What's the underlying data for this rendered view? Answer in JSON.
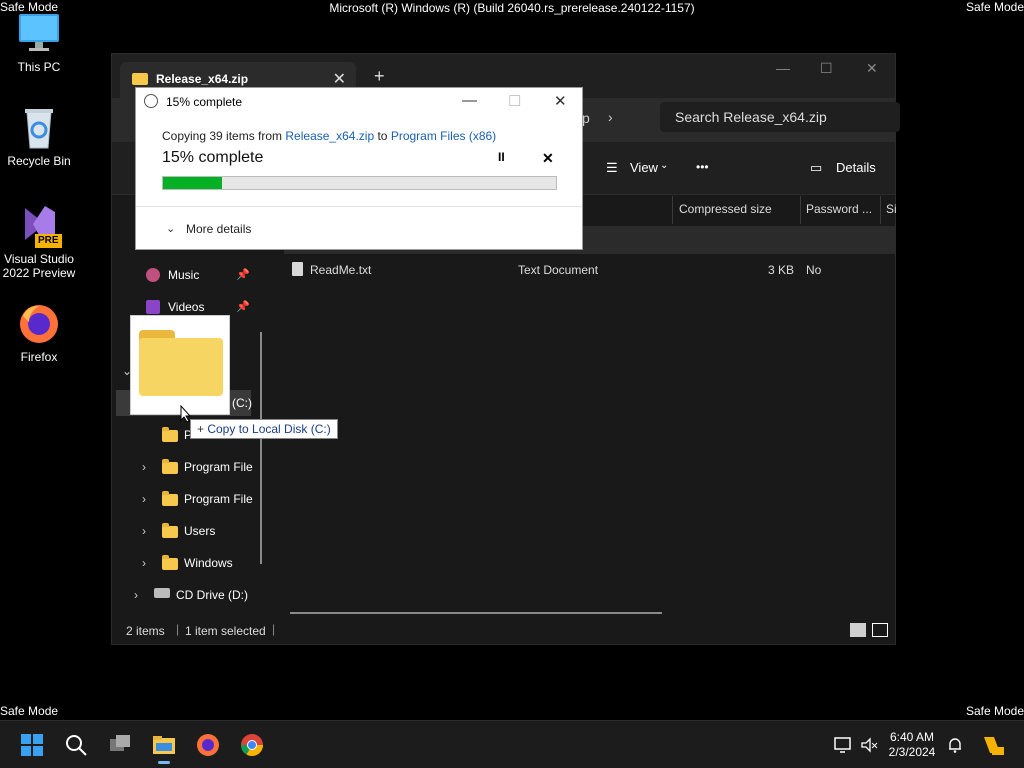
{
  "system": {
    "build_title": "Microsoft (R) Windows (R) (Build 26040.rs_prerelease.240122-1157)",
    "safe_mode": "Safe Mode"
  },
  "desktop": {
    "icons": [
      {
        "label": "This PC",
        "icon": "monitor-icon"
      },
      {
        "label": "Recycle Bin",
        "icon": "recycle-bin-icon"
      },
      {
        "label": "Visual Studio 2022 Preview",
        "icon": "visual-studio-icon",
        "badge": "PRE"
      },
      {
        "label": "Firefox",
        "icon": "firefox-icon"
      }
    ]
  },
  "explorer": {
    "tab_title": "Release_x64.zip",
    "search_placeholder": "Search Release_x64.zip",
    "breadcrumb_tail": "p",
    "toolbar": {
      "view": "View",
      "more": "•••",
      "details": "Details"
    },
    "columns": [
      "Compressed size",
      "Password ...",
      "Si"
    ],
    "files": [
      {
        "name": "ReadMe.txt",
        "type": "Text Document",
        "compressed_size": "3 KB",
        "password": "No"
      }
    ],
    "nav": {
      "music": "Music",
      "videos": "Videos",
      "drive_c_suffix": "(C:)",
      "perflogs_partial": "P",
      "program_files_1": "Program File",
      "program_files_2": "Program File",
      "users": "Users",
      "windows": "Windows",
      "cd_drive": "CD Drive (D:)"
    },
    "status": {
      "items": "2 items",
      "selected": "1 item selected"
    }
  },
  "dialog": {
    "title": "15% complete",
    "copying_prefix": "Copying 39 items from ",
    "source": "Release_x64.zip",
    "to": " to ",
    "destination": "Program Files (x86)",
    "percent_label": "15% complete",
    "progress": 0.15,
    "more_details": "More details"
  },
  "drag": {
    "tooltip": "Copy to Local Disk (C:)"
  },
  "taskbar": {
    "time": "6:40 AM",
    "date": "2/3/2024"
  }
}
